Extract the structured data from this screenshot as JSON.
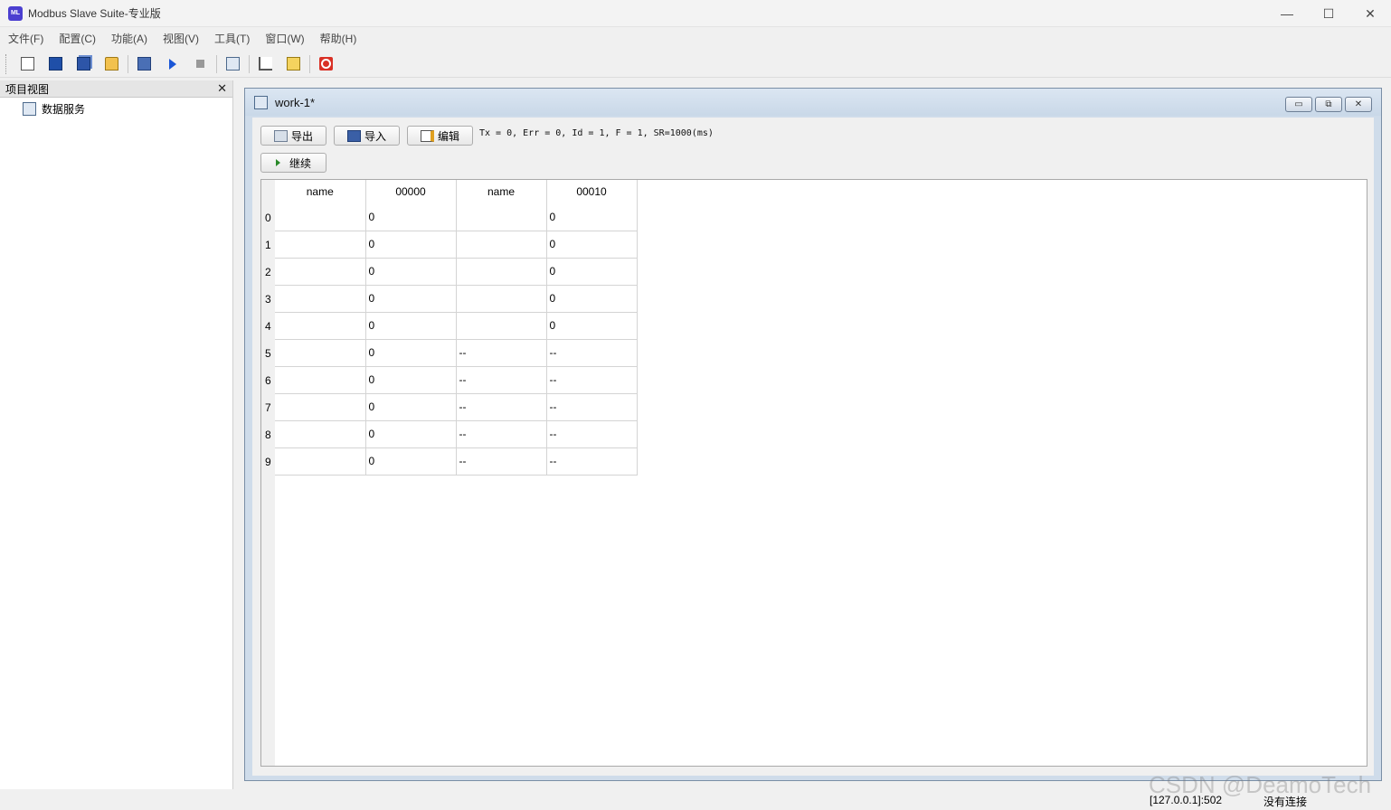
{
  "window": {
    "title": "Modbus Slave Suite-专业版",
    "app_icon_text": "ML",
    "controls": [
      "—",
      "☐",
      "✕"
    ]
  },
  "menu": [
    "文件(F)",
    "配置(C)",
    "功能(A)",
    "视图(V)",
    "工具(T)",
    "窗口(W)",
    "帮助(H)"
  ],
  "toolbar": {
    "icons": [
      "new-icon",
      "save-icon",
      "save-all-icon",
      "open-icon",
      "connect-icon",
      "run-icon",
      "stop-icon",
      "register-view-icon",
      "chart-icon",
      "log-icon",
      "exit-icon"
    ]
  },
  "project_panel": {
    "title": "项目视图",
    "close": "✕",
    "items": [
      {
        "label": "数据服务"
      }
    ]
  },
  "child_window": {
    "title": "work-1*",
    "controls": [
      "▭",
      "⧉",
      "✕"
    ],
    "buttons": {
      "export": "导出",
      "import": "导入",
      "edit": "编辑",
      "continue": "继续"
    },
    "status": "Tx = 0, Err = 0, Id = 1, F = 1, SR=1000(ms)"
  },
  "table": {
    "headers": [
      "name",
      "00000",
      "name",
      "00010"
    ],
    "row_numbers": [
      "0",
      "1",
      "2",
      "3",
      "4",
      "5",
      "6",
      "7",
      "8",
      "9"
    ],
    "rows": [
      [
        "",
        "0",
        "",
        "0"
      ],
      [
        "",
        "0",
        "",
        "0"
      ],
      [
        "",
        "0",
        "",
        "0"
      ],
      [
        "",
        "0",
        "",
        "0"
      ],
      [
        "",
        "0",
        "",
        "0"
      ],
      [
        "",
        "0",
        "--",
        "--"
      ],
      [
        "",
        "0",
        "--",
        "--"
      ],
      [
        "",
        "0",
        "--",
        "--"
      ],
      [
        "",
        "0",
        "--",
        "--"
      ],
      [
        "",
        "0",
        "--",
        "--"
      ]
    ]
  },
  "statusbar": {
    "address": "[127.0.0.1]:502",
    "connection": "没有连接"
  },
  "watermark": "CSDN @DeamoTech"
}
